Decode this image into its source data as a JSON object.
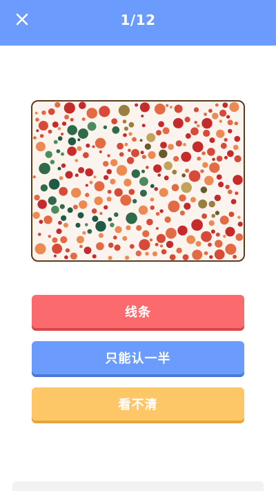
{
  "header": {
    "title": "1/12",
    "close_icon": "close-icon",
    "background": "#6a9bfd"
  },
  "test_plate": {
    "image": "color-blindness-dot-plate",
    "colors": {
      "background_reds": [
        "#c62a2a",
        "#d84a38",
        "#e46a44",
        "#ec8a52"
      ],
      "greens": [
        "#2f6b4a",
        "#1e5a44",
        "#4d8a5e"
      ],
      "olives": [
        "#6b5a2a",
        "#9b7f3e",
        "#c2a35a"
      ],
      "border": "#5b3a1e"
    }
  },
  "options": [
    {
      "label": "线条",
      "color": "#fb6b6d"
    },
    {
      "label": "只能认一半",
      "color": "#6a9bfd"
    },
    {
      "label": "看不清",
      "color": "#fdc768"
    }
  ]
}
